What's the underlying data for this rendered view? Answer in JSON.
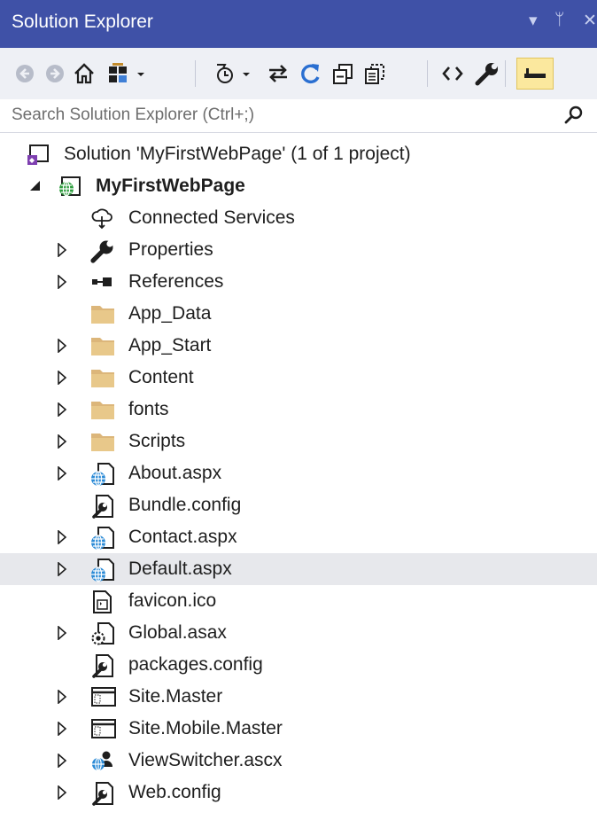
{
  "panel": {
    "title": "Solution Explorer",
    "dropdown_glyph": "▾",
    "pin_glyph": "ᛘ",
    "close_glyph": "✕"
  },
  "toolbar": {
    "buttons": [
      {
        "name": "back-icon"
      },
      {
        "name": "forward-icon"
      },
      {
        "name": "home-icon"
      },
      {
        "name": "switch-views-icon"
      },
      {
        "name": "pending-changes-filter-icon"
      },
      {
        "name": "sync-with-active-document-icon"
      },
      {
        "name": "refresh-icon"
      },
      {
        "name": "collapse-all-icon"
      },
      {
        "name": "show-all-files-icon"
      },
      {
        "name": "view-code-icon"
      },
      {
        "name": "properties-wrench-icon"
      },
      {
        "name": "preview-selected-items-icon",
        "active": true
      }
    ]
  },
  "search": {
    "placeholder": "Search Solution Explorer (Ctrl+;)"
  },
  "colors": {
    "title_bar": "#3f51a7",
    "toolbar_bg": "#eef0f5",
    "selected_row": "#e7e8ec",
    "folder": "#dcb67a",
    "web_globe": "#2e9e3e",
    "active_button": "#fbe89e"
  },
  "tree": {
    "solution": {
      "label": "Solution 'MyFirstWebPage' (1 of 1 project)",
      "icon": "solution-icon"
    },
    "project": {
      "label": "MyFirstWebPage",
      "icon": "web-project-icon",
      "expanded": true
    },
    "items": [
      {
        "label": "Connected Services",
        "icon": "connected-services-icon",
        "expandable": false
      },
      {
        "label": "Properties",
        "icon": "wrench-icon",
        "expandable": true
      },
      {
        "label": "References",
        "icon": "references-icon",
        "expandable": true
      },
      {
        "label": "App_Data",
        "icon": "folder-icon",
        "expandable": false
      },
      {
        "label": "App_Start",
        "icon": "folder-icon",
        "expandable": true
      },
      {
        "label": "Content",
        "icon": "folder-icon",
        "expandable": true
      },
      {
        "label": "fonts",
        "icon": "folder-icon",
        "expandable": true
      },
      {
        "label": "Scripts",
        "icon": "folder-icon",
        "expandable": true
      },
      {
        "label": "About.aspx",
        "icon": "aspx-file-icon",
        "expandable": true
      },
      {
        "label": "Bundle.config",
        "icon": "config-file-icon",
        "expandable": false
      },
      {
        "label": "Contact.aspx",
        "icon": "aspx-file-icon",
        "expandable": true
      },
      {
        "label": "Default.aspx",
        "icon": "aspx-file-icon",
        "expandable": true,
        "selected": true
      },
      {
        "label": "favicon.ico",
        "icon": "ico-file-icon",
        "expandable": false
      },
      {
        "label": "Global.asax",
        "icon": "asax-file-icon",
        "expandable": true
      },
      {
        "label": "packages.config",
        "icon": "config-file-icon",
        "expandable": false
      },
      {
        "label": "Site.Master",
        "icon": "master-page-icon",
        "expandable": true
      },
      {
        "label": "Site.Mobile.Master",
        "icon": "master-page-icon",
        "expandable": true
      },
      {
        "label": "ViewSwitcher.ascx",
        "icon": "user-control-icon",
        "expandable": true
      },
      {
        "label": "Web.config",
        "icon": "config-file-icon",
        "expandable": true
      }
    ]
  }
}
